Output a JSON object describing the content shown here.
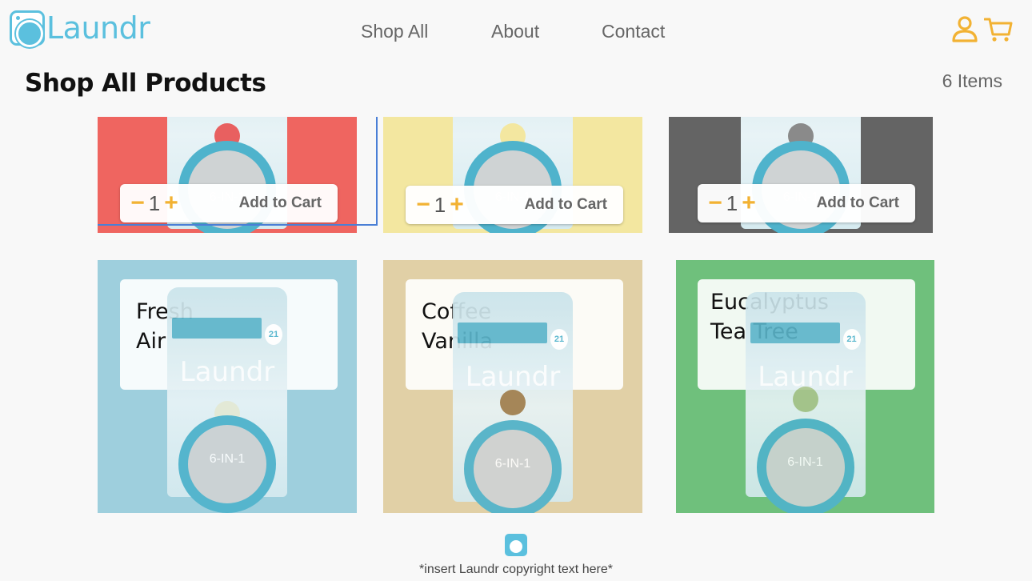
{
  "header": {
    "logo_text": "Laundr",
    "nav": [
      {
        "label": "Shop All"
      },
      {
        "label": "About"
      },
      {
        "label": "Contact"
      }
    ],
    "icons": [
      "user-icon",
      "cart-icon"
    ],
    "accent_color": "#f2b233",
    "brand_color": "#5bc0de"
  },
  "page": {
    "title": "Shop All Products",
    "item_count": "6 Items"
  },
  "products": [
    {
      "name": "",
      "color": "#ef6560",
      "qty": "1",
      "add_label": "Add to Cart",
      "scent_color": "#e86060"
    },
    {
      "name": "",
      "color": "#f3e7a0",
      "qty": "1",
      "add_label": "Add to Cart",
      "scent_color": "#f3e7a0"
    },
    {
      "name": "",
      "color": "#646464",
      "qty": "1",
      "add_label": "Add to Cart",
      "scent_color": "#8a8a8a"
    },
    {
      "name_line1": "Fresh",
      "name_line2": "Air",
      "color": "#9ecfdd",
      "scent_color": "#e9ecd6"
    },
    {
      "name_line1": "Coffee",
      "name_line2": "Vanilla",
      "color": "#e1d0a6",
      "scent_color": "#a08052"
    },
    {
      "name_line1": "Eucalyptus",
      "name_line2": "Tea Tree",
      "color": "#6fc07c",
      "scent_color": "#a9c48c"
    }
  ],
  "bag": {
    "brand": "Laundr",
    "label": "6-IN-1",
    "badge": "21"
  },
  "footer": {
    "text": "*insert Laundr copyright text here*"
  }
}
